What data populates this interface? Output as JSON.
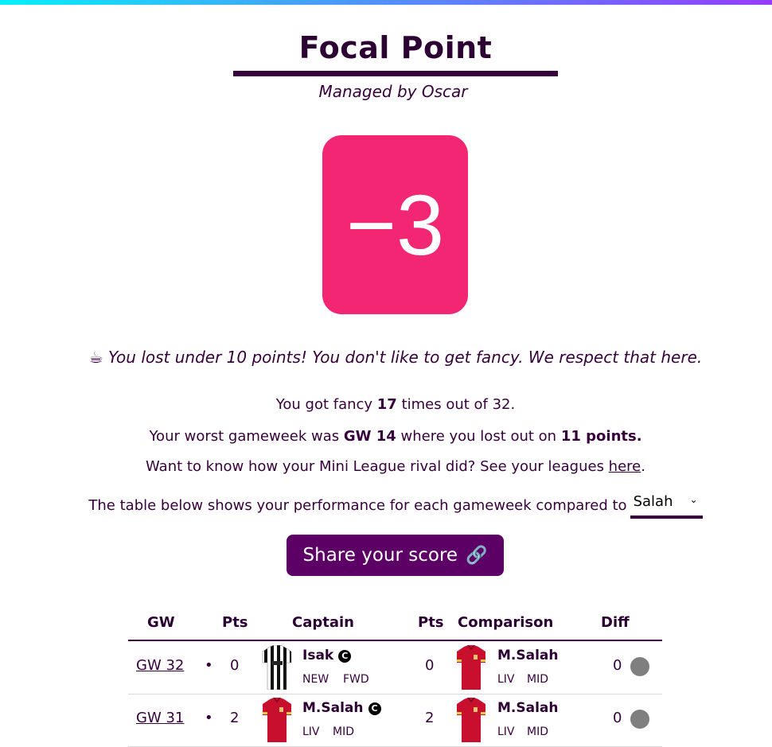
{
  "header": {
    "title": "Focal Point",
    "subtitle": "Managed by Oscar"
  },
  "score": "−3",
  "verdict": {
    "emoji": "☕",
    "text": "You lost under 10 points! You don't like to get fancy. We respect that here."
  },
  "stats": {
    "fancy_pre": "You got fancy ",
    "fancy_count": "17",
    "fancy_post": " times out of 32.",
    "worst_pre": "Your worst gameweek was ",
    "worst_gw": "GW 14",
    "worst_mid": " where you lost out on ",
    "worst_points": "11 points.",
    "rival_pre": "Want to know how your Mini League rival did? See your leagues ",
    "rival_link": "here",
    "rival_post": ".",
    "table_intro": "The table below shows your performance for each gameweek compared to"
  },
  "compare_select": {
    "value": "Salah",
    "chevron": "⌄"
  },
  "share_button": {
    "label": "Share your score",
    "icon": "link-icon",
    "icon_glyph": "🔗"
  },
  "table": {
    "headers": {
      "gw": "GW",
      "pts": "Pts",
      "captain": "Captain",
      "pts2": "Pts",
      "comparison": "Comparison",
      "diff": "Diff"
    },
    "rows": [
      {
        "gw": "GW 32",
        "dot": "•",
        "pts": "0",
        "captain": {
          "name": "Isak",
          "badge": "C",
          "team": "NEW",
          "pos": "FWD",
          "kit": "newcastle"
        },
        "comp_pts": "0",
        "comparison": {
          "name": "M.Salah",
          "team": "LIV",
          "pos": "MID",
          "kit": "liverpool"
        },
        "diff": "0"
      },
      {
        "gw": "GW 31",
        "dot": "•",
        "pts": "2",
        "captain": {
          "name": "M.Salah",
          "badge": "C",
          "team": "LIV",
          "pos": "MID",
          "kit": "liverpool"
        },
        "comp_pts": "2",
        "comparison": {
          "name": "M.Salah",
          "team": "LIV",
          "pos": "MID",
          "kit": "liverpool"
        },
        "diff": "0"
      }
    ]
  },
  "colors": {
    "score_bg": "#f22673",
    "primary": "#37003c",
    "button_bg": "#5c0066",
    "neutral_dot": "#7f7f7f"
  }
}
